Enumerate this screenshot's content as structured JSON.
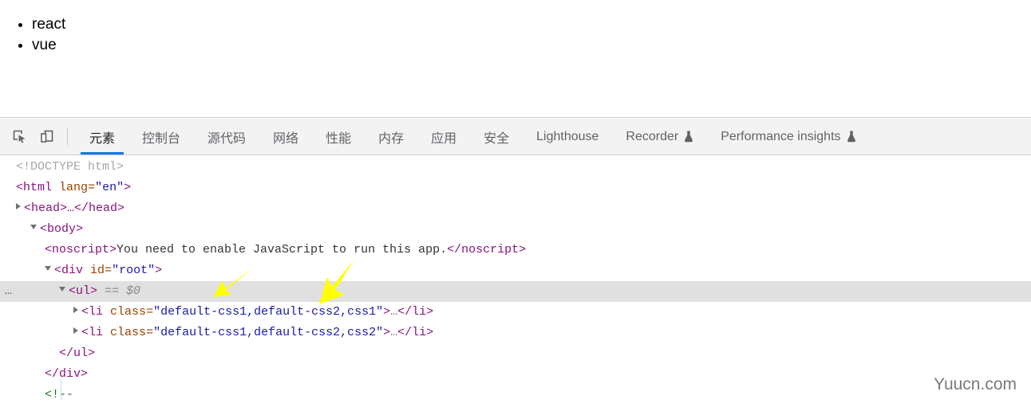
{
  "page": {
    "list_items": [
      "react",
      "vue"
    ]
  },
  "devtools": {
    "toolbar": {
      "inspect_icon": "inspect-element-icon",
      "device_icon": "device-toolbar-icon"
    },
    "tabs": [
      {
        "label": "元素",
        "active": true,
        "icon": ""
      },
      {
        "label": "控制台",
        "active": false,
        "icon": ""
      },
      {
        "label": "源代码",
        "active": false,
        "icon": ""
      },
      {
        "label": "网络",
        "active": false,
        "icon": ""
      },
      {
        "label": "性能",
        "active": false,
        "icon": ""
      },
      {
        "label": "内存",
        "active": false,
        "icon": ""
      },
      {
        "label": "应用",
        "active": false,
        "icon": ""
      },
      {
        "label": "安全",
        "active": false,
        "icon": ""
      },
      {
        "label": "Lighthouse",
        "active": false,
        "icon": ""
      },
      {
        "label": "Recorder",
        "active": false,
        "icon": "flask-icon"
      },
      {
        "label": "Performance insights",
        "active": false,
        "icon": "flask-icon"
      }
    ],
    "dom": {
      "doctype": "<!DOCTYPE html>",
      "html_open_lt": "<",
      "html_tag": "html",
      "html_attr_name": "lang",
      "html_attr_eq": "=",
      "html_attr_value": "\"en\"",
      "html_open_gt": ">",
      "head_collapsed": "<head>…</head>",
      "body_open": "<body>",
      "noscript_open": "<noscript>",
      "noscript_text": "You need to enable JavaScript to run this app.",
      "noscript_close": "</noscript>",
      "div_open_lt": "<",
      "div_tag": "div",
      "div_attr_name": "id",
      "div_attr_eq": "=",
      "div_attr_value": "\"root\"",
      "div_open_gt": ">",
      "ul_open": "<ul>",
      "ul_selected_marker": "== $0",
      "ul_dots": "…",
      "li1_lt": "<",
      "li1_tag": "li",
      "li1_attr_name": "class",
      "li1_attr_eq": "=",
      "li1_attr_value": "\"default-css1,default-css2,css1\"",
      "li1_gt": ">",
      "li1_ellipsis": "…",
      "li1_close": "</li>",
      "li2_lt": "<",
      "li2_tag": "li",
      "li2_attr_name": "class",
      "li2_attr_eq": "=",
      "li2_attr_value": "\"default-css1,default-css2,css2\"",
      "li2_gt": ">",
      "li2_ellipsis": "…",
      "li2_close": "</li>",
      "ul_close": "</ul>",
      "div_close": "</div>",
      "comment_open": "<!--"
    }
  },
  "annotations": {
    "arrow_color": "#ffff00",
    "arrow_count": 2
  },
  "watermark": {
    "text": "Yuucn.com"
  }
}
